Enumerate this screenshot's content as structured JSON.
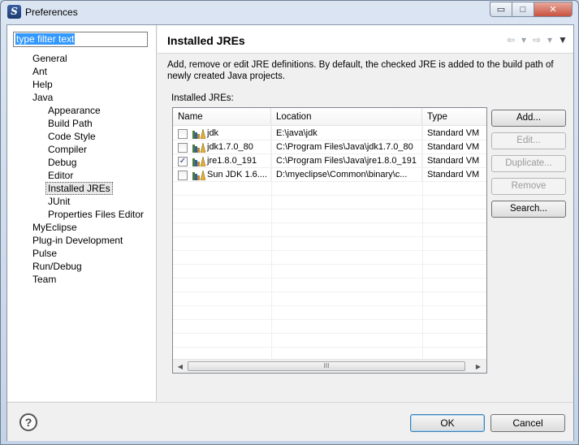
{
  "window": {
    "title": "Preferences",
    "close_glyph": "✕",
    "minimize_glyph": "▭",
    "maximize_glyph": "□"
  },
  "filter": {
    "value": "type filter text"
  },
  "tree": [
    {
      "label": "General",
      "indent": 0,
      "selected": false
    },
    {
      "label": "Ant",
      "indent": 0,
      "selected": false
    },
    {
      "label": "Help",
      "indent": 0,
      "selected": false
    },
    {
      "label": "Java",
      "indent": 0,
      "selected": false
    },
    {
      "label": "Appearance",
      "indent": 1,
      "selected": false
    },
    {
      "label": "Build Path",
      "indent": 1,
      "selected": false
    },
    {
      "label": "Code Style",
      "indent": 1,
      "selected": false
    },
    {
      "label": "Compiler",
      "indent": 1,
      "selected": false
    },
    {
      "label": "Debug",
      "indent": 1,
      "selected": false
    },
    {
      "label": "Editor",
      "indent": 1,
      "selected": false
    },
    {
      "label": "Installed JREs",
      "indent": 1,
      "selected": true
    },
    {
      "label": "JUnit",
      "indent": 1,
      "selected": false
    },
    {
      "label": "Properties Files Editor",
      "indent": 1,
      "selected": false
    },
    {
      "label": "MyEclipse",
      "indent": 0,
      "selected": false
    },
    {
      "label": "Plug-in Development",
      "indent": 0,
      "selected": false
    },
    {
      "label": "Pulse",
      "indent": 0,
      "selected": false
    },
    {
      "label": "Run/Debug",
      "indent": 0,
      "selected": false
    },
    {
      "label": "Team",
      "indent": 0,
      "selected": false
    }
  ],
  "page": {
    "title": "Installed JREs",
    "description": "Add, remove or edit JRE definitions. By default, the checked JRE is added to the build path of newly created Java projects.",
    "list_label": "Installed JREs:"
  },
  "table": {
    "columns": [
      "Name",
      "Location",
      "Type"
    ],
    "rows": [
      {
        "checked": false,
        "name": "jdk",
        "location": "E:\\java\\jdk",
        "type": "Standard VM"
      },
      {
        "checked": false,
        "name": "jdk1.7.0_80",
        "location": "C:\\Program Files\\Java\\jdk1.7.0_80",
        "type": "Standard VM"
      },
      {
        "checked": true,
        "name": "jre1.8.0_191",
        "location": "C:\\Program Files\\Java\\jre1.8.0_191",
        "type": "Standard VM"
      },
      {
        "checked": false,
        "name": "Sun JDK 1.6....",
        "location": "D:\\myeclipse\\Common\\binary\\c...",
        "type": "Standard VM"
      }
    ],
    "scroll_grip": "III"
  },
  "buttons": {
    "add": "Add...",
    "edit": "Edit...",
    "duplicate": "Duplicate...",
    "remove": "Remove",
    "search": "Search...",
    "ok": "OK",
    "cancel": "Cancel"
  },
  "icons": {
    "back": "arrow-left-icon",
    "forward": "arrow-right-icon",
    "menu": "view-menu-icon",
    "help": "help-icon",
    "jre": "jre-library-icon"
  },
  "colors": {
    "selection": "#3399ff",
    "accent_button_border": "#3c7fb1"
  }
}
